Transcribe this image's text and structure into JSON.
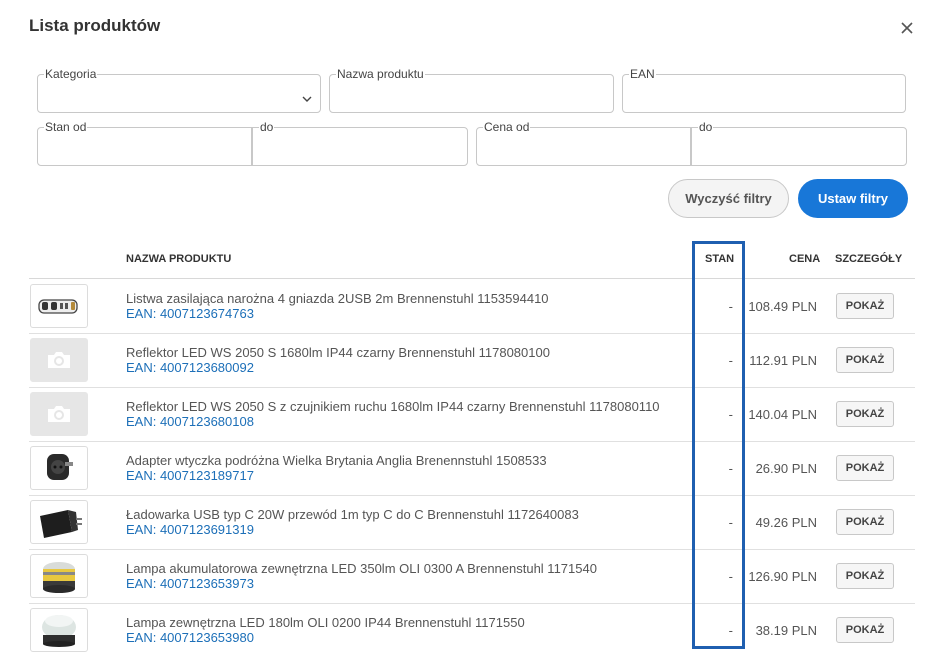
{
  "dialog": {
    "title": "Lista produktów"
  },
  "filters": {
    "category_label": "Kategoria",
    "category_value": "",
    "product_name_label": "Nazwa produktu",
    "product_name_value": "",
    "ean_label": "EAN",
    "ean_value": "",
    "stock_from_label": "Stan od",
    "stock_to_label": "do",
    "price_from_label": "Cena od",
    "price_to_label": "do",
    "clear_label": "Wyczyść filtry",
    "apply_label": "Ustaw filtry"
  },
  "table": {
    "headers": {
      "name": "NAZWA PRODUKTU",
      "stock": "STAN",
      "price": "CENA",
      "details": "SZCZEGÓŁY"
    },
    "rows": [
      {
        "name": "Listwa zasilająca narożna 4 gniazda 2USB 2m Brennenstuhl 1153594410",
        "ean": "EAN: 4007123674763",
        "stock": "-",
        "price": "108.49 PLN",
        "action": "POKAŻ",
        "thumb": "power-strip"
      },
      {
        "name": "Reflektor LED WS 2050 S 1680lm IP44 czarny Brennenstuhl 1178080100",
        "ean": "EAN: 4007123680092",
        "stock": "-",
        "price": "112.91 PLN",
        "action": "POKAŻ",
        "thumb": "camera-placeholder"
      },
      {
        "name": "Reflektor LED WS 2050 S z czujnikiem ruchu 1680lm IP44 czarny Brennenstuhl 1178080110",
        "ean": "EAN: 4007123680108",
        "stock": "-",
        "price": "140.04 PLN",
        "action": "POKAŻ",
        "thumb": "camera-placeholder"
      },
      {
        "name": "Adapter wtyczka podróżna Wielka Brytania Anglia Brenennstuhl 1508533",
        "ean": "EAN: 4007123189717",
        "stock": "-",
        "price": "26.90 PLN",
        "action": "POKAŻ",
        "thumb": "travel-adapter"
      },
      {
        "name": "Ładowarka USB typ C 20W przewód 1m typ C do C Brennenstuhl 1172640083",
        "ean": "EAN: 4007123691319",
        "stock": "-",
        "price": "49.26 PLN",
        "action": "POKAŻ",
        "thumb": "usb-charger"
      },
      {
        "name": "Lampa akumulatorowa zewnętrzna LED 350lm OLI 0300 A Brennenstuhl 1171540",
        "ean": "EAN: 4007123653973",
        "stock": "-",
        "price": "126.90 PLN",
        "action": "POKAŻ",
        "thumb": "lamp-yellow"
      },
      {
        "name": "Lampa zewnętrzna LED 180lm OLI 0200 IP44 Brennenstuhl 1171550",
        "ean": "EAN: 4007123653980",
        "stock": "-",
        "price": "38.19 PLN",
        "action": "POKAŻ",
        "thumb": "lamp-white"
      }
    ]
  },
  "colors": {
    "accent": "#1877d8",
    "link": "#1c6fb8",
    "highlight_border": "#1f5fb0"
  }
}
